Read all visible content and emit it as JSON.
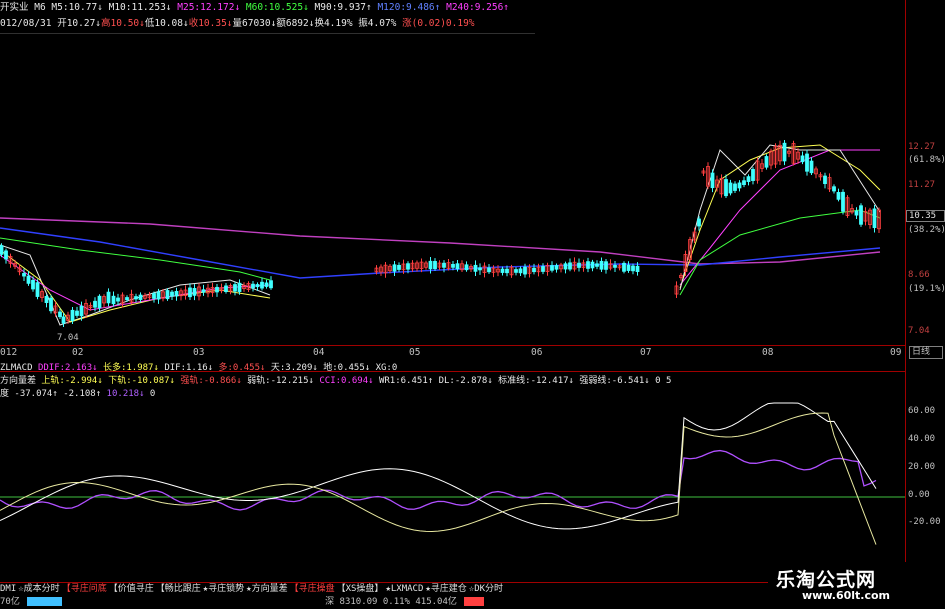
{
  "header": {
    "line1": [
      {
        "text": "开实业",
        "cls": "w"
      },
      {
        "text": " M6 ",
        "cls": "w"
      },
      {
        "text": "M5:10.77↓",
        "cls": "w"
      },
      {
        "text": " M10:11.253↓",
        "cls": "w"
      },
      {
        "text": " M25:12.172↓",
        "cls": "m"
      },
      {
        "text": " M60:10.525↓",
        "cls": "g"
      },
      {
        "text": " M90:9.937↑",
        "cls": "w"
      },
      {
        "text": " M120:9.486↑",
        "cls": "b"
      },
      {
        "text": " M240:9.256↑",
        "cls": "m"
      }
    ],
    "line2": [
      {
        "text": "012/08/31 ",
        "cls": "w"
      },
      {
        "text": "开10.27↓",
        "cls": "w"
      },
      {
        "text": "高10.50↓",
        "cls": "r"
      },
      {
        "text": "低10.08↓",
        "cls": "w"
      },
      {
        "text": "收10.35↓",
        "cls": "r"
      },
      {
        "text": "量67030↓",
        "cls": "w"
      },
      {
        "text": "额6892↓",
        "cls": "w"
      },
      {
        "text": "换4.19%",
        "cls": "w"
      },
      {
        "text": " 振4.07%",
        "cls": "w"
      },
      {
        "text": " 涨(0.02)0.19%",
        "cls": "r"
      }
    ]
  },
  "price_axis": {
    "labels": [
      {
        "text": "12.27",
        "cls": ""
      },
      {
        "text": "(61.8%)",
        "cls": "pct"
      },
      {
        "text": "11.27",
        "cls": ""
      },
      {
        "text": "(38.2%)",
        "cls": "pct"
      },
      {
        "text": "8.66",
        "cls": ""
      },
      {
        "text": "(19.1%)",
        "cls": "pct"
      },
      {
        "text": "7.04",
        "cls": ""
      }
    ],
    "current": "10.35",
    "low_marker": "7.04"
  },
  "dates": {
    "labels": [
      "012",
      "02",
      "03",
      "04",
      "05",
      "06",
      "07",
      "08",
      "09"
    ],
    "box": "日线"
  },
  "indicators": {
    "row1": [
      {
        "text": "ZLMACD ",
        "cls": "w"
      },
      {
        "text": "DDIF:2.163↓",
        "cls": "m"
      },
      {
        "text": " 长多:1.987↓",
        "cls": "y"
      },
      {
        "text": " DIF:1.16↓",
        "cls": "w"
      },
      {
        "text": " 多:0.455↓",
        "cls": "r"
      },
      {
        "text": " 天:3.209↓",
        "cls": "w"
      },
      {
        "text": " 地:0.455↓",
        "cls": "w"
      },
      {
        "text": " XG:0",
        "cls": "w"
      }
    ],
    "row2": [
      {
        "text": "方向量差 ",
        "cls": "w"
      },
      {
        "text": "上轨:-2.994↓",
        "cls": "y"
      },
      {
        "text": " 下轨:-10.087↓",
        "cls": "y"
      },
      {
        "text": " 强轨:-0.866↓",
        "cls": "r"
      },
      {
        "text": " 弱轨:-12.215↓",
        "cls": "w"
      },
      {
        "text": " CCI:0.694↓",
        "cls": "m"
      },
      {
        "text": " WR1:6.451↑",
        "cls": "w"
      },
      {
        "text": " DL:-2.878↓",
        "cls": "w"
      },
      {
        "text": " 标准线:-12.417↓",
        "cls": "w"
      },
      {
        "text": " 强弱线:-6.541↓",
        "cls": "w"
      },
      {
        "text": " 0 5",
        "cls": "w"
      }
    ],
    "row3": [
      {
        "text": "度 ",
        "cls": "w"
      },
      {
        "text": "-37.074↑",
        "cls": "w"
      },
      {
        "text": " -2.108↑",
        "cls": "w"
      },
      {
        "text": " 10.218↓",
        "cls": "v"
      },
      {
        "text": " 0",
        "cls": "w"
      }
    ]
  },
  "sub_axis": [
    "60.00",
    "40.00",
    "20.00",
    "0.00",
    "-20.00"
  ],
  "tabs": [
    {
      "label": "DMI",
      "hl": false
    },
    {
      "label": "☆成本分时",
      "hl": false
    },
    {
      "label": "【寻庄问底",
      "hl": true
    },
    {
      "label": "【价值寻庄",
      "hl": false
    },
    {
      "label": "【畅比跟庄",
      "hl": false
    },
    {
      "label": "★寻庄锁势",
      "hl": false
    },
    {
      "label": "★方向量差",
      "hl": false
    },
    {
      "label": "【寻庄操盘",
      "hl": true
    },
    {
      "label": "【XS操盘】",
      "hl": false
    },
    {
      "label": "★LXMACD",
      "hl": false
    },
    {
      "label": "★寻庄建仓",
      "hl": false
    },
    {
      "label": "☆DK分时",
      "hl": false
    }
  ],
  "status": {
    "left": "70亿",
    "mid": "深 8310.09 0.11% 415.04亿"
  },
  "watermark": {
    "line1": "乐淘公式网",
    "line2": "www.60lt.com"
  },
  "colors": {
    "up": "#ff4040",
    "down": "#40ffff",
    "ma5": "#e8e8e8",
    "ma10": "#ffff54",
    "ma25": "#ff40ff",
    "ma60": "#40ff40",
    "ma120": "#3040ff",
    "ma240": "#c040c0"
  }
}
